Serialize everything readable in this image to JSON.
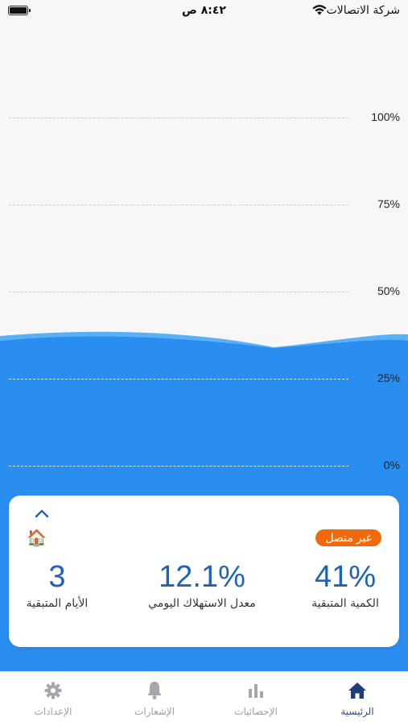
{
  "status_bar": {
    "carrier": "شركة الاتصالات",
    "time": "٨:٤٢ ص"
  },
  "chart": {
    "ticks": [
      "100%",
      "75%",
      "50%",
      "25%",
      "0%"
    ],
    "level_percent": 41,
    "water_color": "#2a8ef0",
    "wave_color": "#5ab0f5"
  },
  "card": {
    "status_badge": "غير متصل",
    "badge_color": "#f06a0c",
    "stats": [
      {
        "value": "41%",
        "label": "الكمية المتبقية"
      },
      {
        "value": "12.1%",
        "label": "معدل الاستهلاك اليومي"
      },
      {
        "value": "3",
        "label": "الأيام المتبقية"
      }
    ]
  },
  "tabs": [
    {
      "label": "الرئيسية",
      "icon": "home-icon",
      "active": true
    },
    {
      "label": "الإحصائيات",
      "icon": "bar-chart-icon",
      "active": false
    },
    {
      "label": "الإشعارات",
      "icon": "bell-icon",
      "active": false
    },
    {
      "label": "الإعدادات",
      "icon": "gear-icon",
      "active": false
    }
  ]
}
